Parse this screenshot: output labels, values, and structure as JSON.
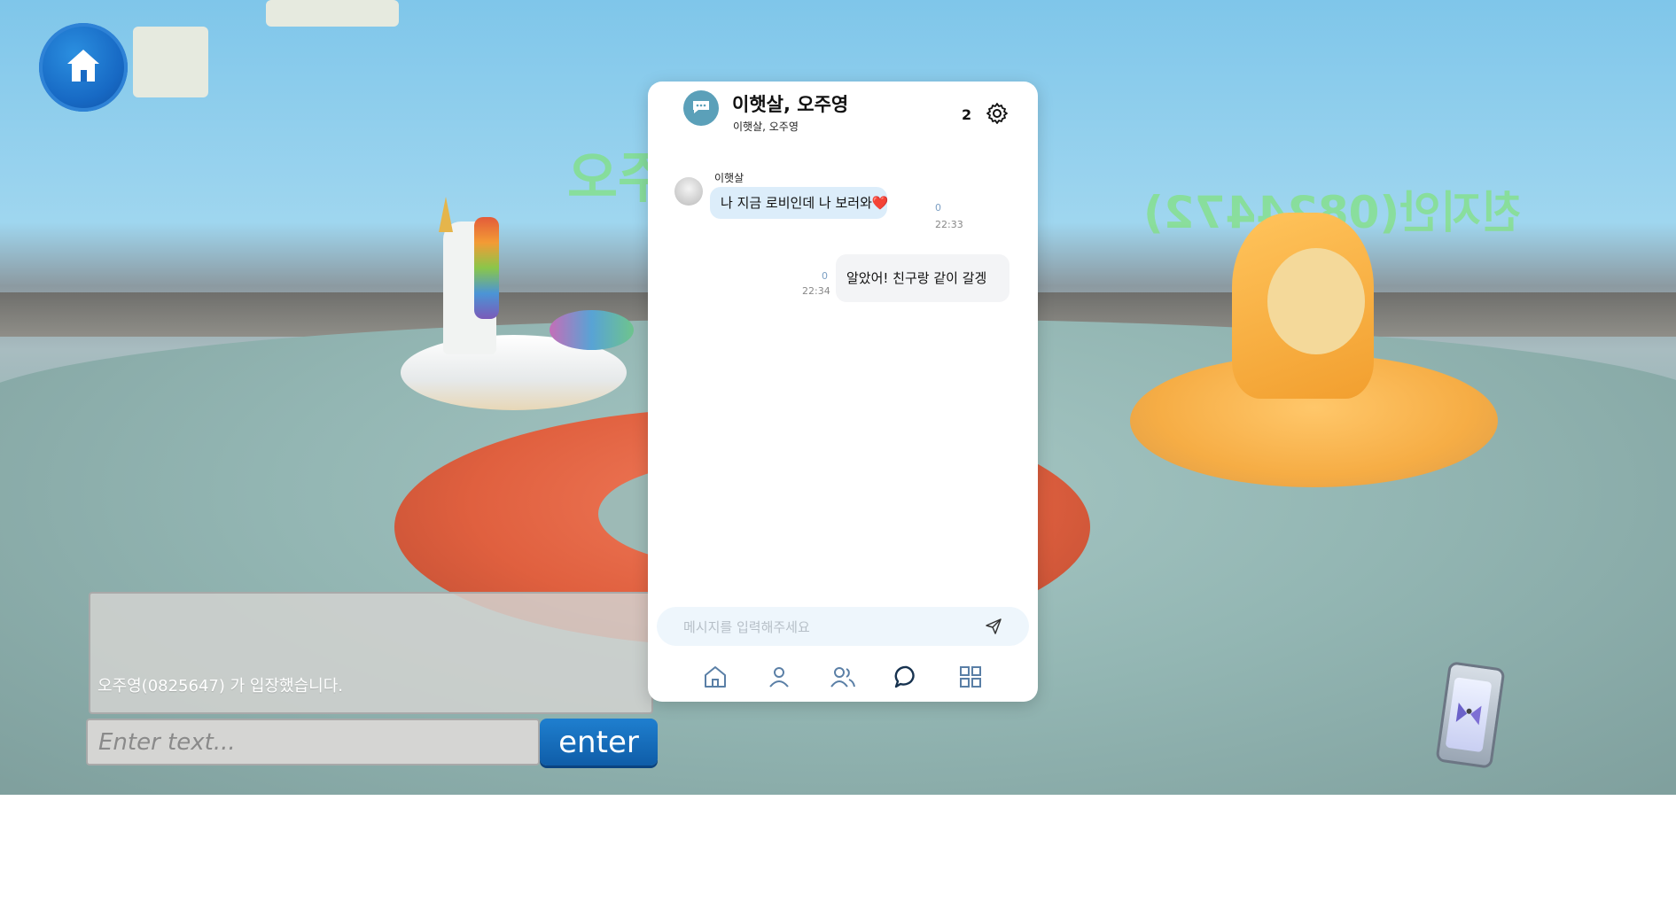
{
  "scene": {
    "floating_names": [
      "오주영",
      "친지안(0824472)"
    ]
  },
  "home_button": {
    "icon": "house-icon"
  },
  "chat": {
    "log_line": "오주영(0825647) 가 입장했습니다.",
    "input_placeholder": "Enter text...",
    "enter_label": "enter"
  },
  "phone_button": {
    "icon": "phone-icon"
  },
  "messenger": {
    "room_title": "이햇살, 오주영",
    "room_subtitle": "이햇살, 오주영",
    "member_count": "2",
    "messages": [
      {
        "sender": "이햇살",
        "text": "나 지금 로비인데 나 보러와",
        "emoji": "❤️",
        "unread": "0",
        "time": "22:33",
        "direction": "in"
      },
      {
        "text": "알았어! 친구랑 같이 갈겡",
        "unread": "0",
        "time": "22:34",
        "direction": "out"
      }
    ],
    "input_placeholder": "메시지를 입력해주세요",
    "nav": [
      "home-icon",
      "person-icon",
      "people-icon",
      "chat-icon",
      "grid-icon"
    ],
    "accent_color": "#5ba0b9"
  }
}
